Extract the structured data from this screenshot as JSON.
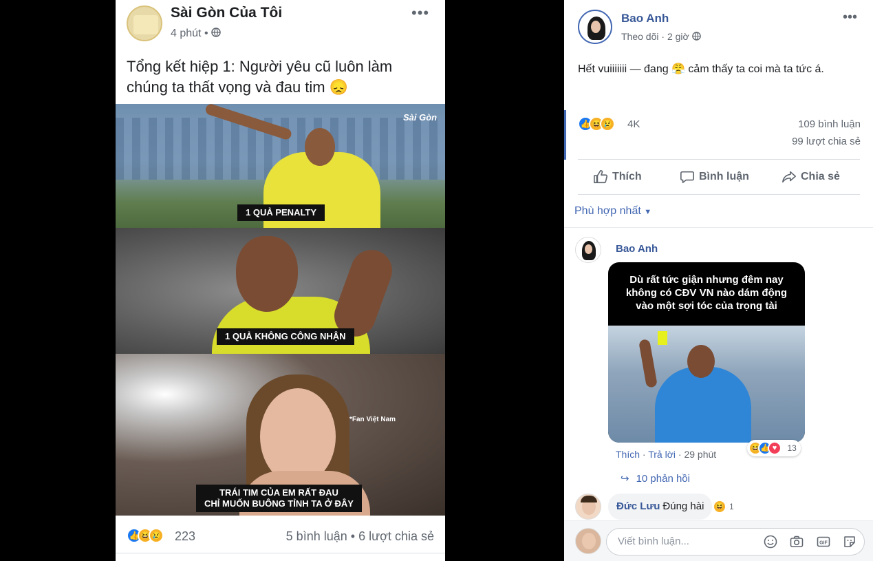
{
  "left_post": {
    "page_name": "Sài Gòn Của Tôi",
    "time": "4 phút",
    "privacy_icon": "globe-icon",
    "text": "Tổng kết hiệp 1: Người yêu cũ luôn làm chúng ta thất vọng và đau tim 😞",
    "image": {
      "watermark": "Sài Gòn",
      "caption_1": "1 QUẢ PENALTY",
      "caption_2": "1 QUẢ KHÔNG CÔNG NHẬN",
      "caption_3_line1": "TRÁI TIM CỦA EM RẤT ĐAU",
      "caption_3_line2": "CHỈ MUỐN BUÔNG TỈNH TA Ở ĐÂY",
      "fan_label": "*Fan Việt Nam"
    },
    "reaction_count": "223",
    "comments": "5 bình luận",
    "separator": "•",
    "shares": "6 lượt chia sẻ"
  },
  "right_post": {
    "author": "Bao Anh",
    "follow": "Theo dõi",
    "separator": "·",
    "time": "2 giờ",
    "privacy_icon": "globe-icon",
    "text": "Hết vuiiiiiii — đang 😤  cảm thấy ta coi mà ta tức á.",
    "reaction_count": "4K",
    "comments": "109 bình luận",
    "shares": "99 lượt chia sẻ",
    "actions": {
      "like": "Thích",
      "comment": "Bình luận",
      "share": "Chia sẻ"
    },
    "sort_label": "Phù hợp nhất",
    "comment_1": {
      "author": "Bao Anh",
      "image_text": "Dù rất tức giận nhưng đêm nay không có CĐV VN nào dám động vào một sợi tóc của trọng tài",
      "reaction_count": "13",
      "like": "Thích",
      "reply": "Trả lời",
      "time": "29 phút",
      "replies": "10 phản hồi"
    },
    "comment_2": {
      "author": "Đức Lưu",
      "text": "Đúng hài",
      "reaction_count": "1"
    },
    "write_placeholder": "Viết bình luận...",
    "accent_color": "#4267b2",
    "name_color": "#385898"
  }
}
